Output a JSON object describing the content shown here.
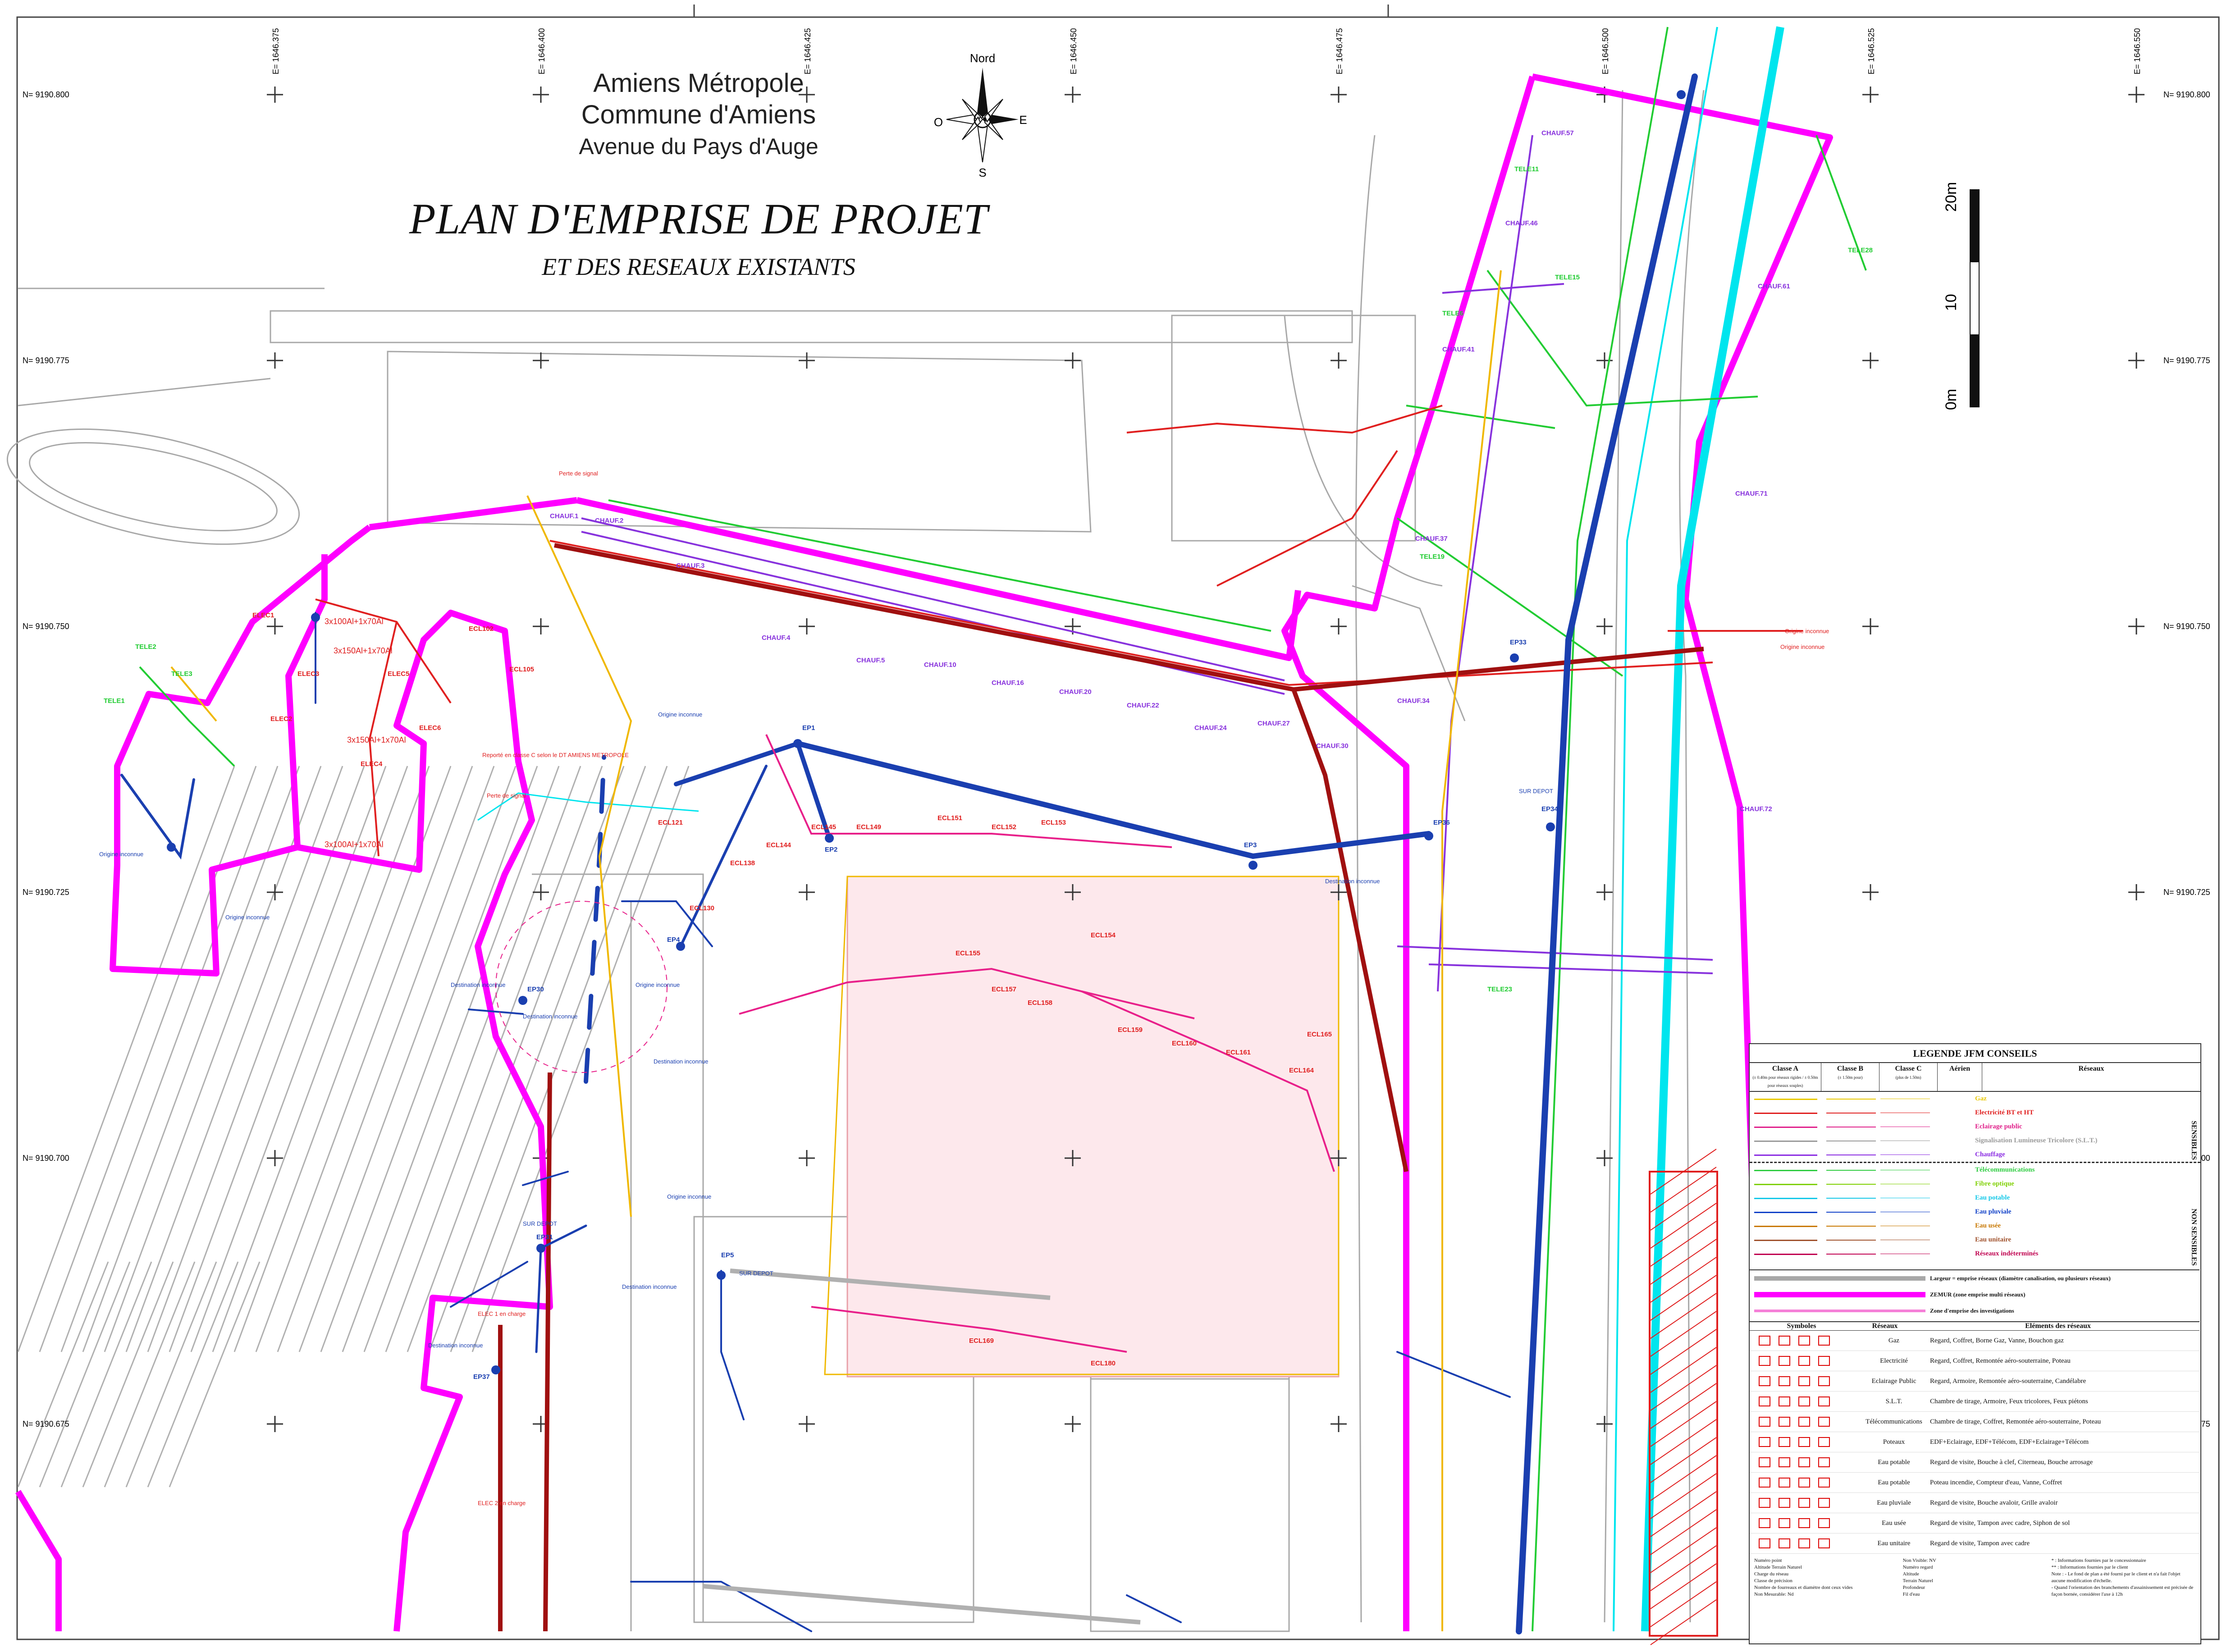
{
  "title": {
    "line1": "Amiens Métropole",
    "line2": "Commune d'Amiens",
    "line3": "Avenue du Pays d'Auge",
    "main": "PLAN D'EMPRISE DE PROJET",
    "sub": "ET DES RESEAUX EXISTANTS"
  },
  "compass": {
    "north": "Nord",
    "south": "S",
    "east": "E",
    "west": "O"
  },
  "scale": {
    "labels": [
      "0m",
      "10",
      "20m"
    ]
  },
  "grid": {
    "eastings": [
      "E= 1646.375",
      "E= 1646.400",
      "E= 1646.425",
      "E= 1646.450",
      "E= 1646.475",
      "E= 1646.500",
      "E= 1646.525",
      "E= 1646.550"
    ],
    "northings": [
      "N= 9190.800",
      "N= 9190.775",
      "N= 9190.750",
      "N= 9190.725",
      "N= 9190.700",
      "N= 9190.675"
    ]
  },
  "annotations": {
    "origine": "Origine inconnue",
    "destination": "Destination inconnue",
    "sur_depot": "SUR DEPOT",
    "elec_charge": "ELEC 1 en charge",
    "elec_charge2": "ELEC 2 en charge",
    "report": "Reporté en classe C selon le DT AMIENS METROPOLE",
    "perte": "Perte de signal",
    "cable1": "3x150Al+1x70Al",
    "cable2": "3x100Al+1x70Al",
    "emprise": "ZEMUR"
  },
  "labels_red": [
    "ELEC1",
    "ELEC2",
    "ELEC3",
    "ELEC4",
    "ELEC5",
    "ELEC6",
    "ECL102",
    "ECL105",
    "ECL121",
    "ECL130",
    "ECL138",
    "ECL144",
    "ECL145",
    "ECL149",
    "ECL151",
    "ECL152",
    "ECL153",
    "ECL154",
    "ECL155",
    "ECL157",
    "ECL158",
    "ECL159",
    "ECL160",
    "ECL161",
    "ECL164",
    "ECL165",
    "ECL169",
    "ECL180"
  ],
  "labels_purple": [
    "CHAUF.1",
    "CHAUF.2",
    "CHAUF.3",
    "CHAUF.4",
    "CHAUF.5",
    "CHAUF.10",
    "CHAUF.16",
    "CHAUF.20",
    "CHAUF.22",
    "CHAUF.24",
    "CHAUF.27",
    "CHAUF.30",
    "CHAUF.34",
    "CHAUF.37",
    "CHAUF.41",
    "CHAUF.46",
    "CHAUF.57",
    "CHAUF.61",
    "CHAUF.71",
    "CHAUF.72"
  ],
  "labels_green": [
    "TELE1",
    "TELE2",
    "TELE3",
    "TELE6",
    "TELE11",
    "TELE15",
    "TELE19",
    "TELE23",
    "TELE28"
  ],
  "labels_blue": [
    "EP1",
    "EP2",
    "EP3",
    "EP4",
    "EP5",
    "EP30",
    "EP31",
    "EP33",
    "EP34",
    "EP36",
    "EP37"
  ],
  "legend": {
    "title": "LEGENDE JFM CONSEILS",
    "cols": [
      "Classe A",
      "Classe B",
      "Classe C",
      "Aérien",
      "Réseaux"
    ],
    "col_notes": [
      "(± 0.40m pour réseaux rigides / ± 0.50m pour réseaux souples)",
      "(± 1.50m pour)",
      "(plus de 1.50m)"
    ],
    "networks": [
      {
        "name": "Gaz",
        "color": "#e8c800"
      },
      {
        "name": "Electricité BT et HT",
        "color": "#e02020"
      },
      {
        "name": "Eclairage public",
        "color": "#e0208a"
      },
      {
        "name": "Signalisation Lumineuse Tricolore (S.L.T.)",
        "color": "#9a9a9a"
      },
      {
        "name": "Chauffage",
        "color": "#8a2be2"
      },
      {
        "name": "Télécommunications",
        "color": "#2ecc40"
      },
      {
        "name": "Fibre optique",
        "color": "#7fd000"
      },
      {
        "name": "Eau potable",
        "color": "#14c8e8"
      },
      {
        "name": "Eau pluviale",
        "color": "#1040c8"
      },
      {
        "name": "Eau usée",
        "color": "#c87800"
      },
      {
        "name": "Eau unitaire",
        "color": "#a0522d"
      },
      {
        "name": "Réseaux indéterminés",
        "color": "#c00050"
      }
    ],
    "sens_top": "SENSIBLES",
    "sens_bottom": "NON SENSIBLES",
    "emprise_rows": [
      "Largeur = emprise réseaux (diamètre canalisation, ou plusieurs réseaux)",
      "ZEMUR (zone emprise multi réseaux)",
      "Zone d'emprise des investigations"
    ],
    "sym_cols": [
      "Symboles",
      "Réseaux",
      "Eléments des réseaux"
    ],
    "symbols": [
      {
        "net": "Gaz",
        "el": "Regard, Coffret, Borne Gaz, Vanne, Bouchon gaz"
      },
      {
        "net": "Electricité",
        "el": "Regard, Coffret, Remontée aéro-souterraine, Poteau"
      },
      {
        "net": "Eclairage Public",
        "el": "Regard, Armoire, Remontée aéro-souterraine, Candélabre"
      },
      {
        "net": "S.L.T.",
        "el": "Chambre de tirage, Armoire, Feux tricolores, Feux piétons"
      },
      {
        "net": "Télécommunications",
        "el": "Chambre de tirage, Coffret, Remontée aéro-souterraine, Poteau"
      },
      {
        "net": "Poteaux",
        "el": "EDF+Eclairage, EDF+Télécom, EDF+Eclairage+Télécom"
      },
      {
        "net": "Eau potable",
        "el": "Regard de visite, Bouche à clef, Citerneau, Bouche arrosage"
      },
      {
        "net": "Eau potable",
        "el": "Poteau incendie, Compteur d'eau, Vanne, Coffret"
      },
      {
        "net": "Eau pluviale",
        "el": "Regard de visite, Bouche avaloir, Grille avaloir"
      },
      {
        "net": "Eau usée",
        "el": "Regard de visite, Tampon avec cadre, Siphon de sol"
      },
      {
        "net": "Eau unitaire",
        "el": "Regard de visite, Tampon avec cadre"
      }
    ],
    "footer": [
      "Numéro point",
      "Altitude Terrain Naturel",
      "Charge du réseau",
      "Classe de précision",
      "Nombre de fourreaux et diamètre dont ceux vides",
      "Non Mesurable: Nd",
      "Non Visible: NV",
      "Numéro regard",
      "Altitude",
      "Terrain Naturel",
      "Profondeur",
      "Fil d'eau",
      "* : Informations fournies par le concessionnaire",
      "** : Informations fournies par le client",
      "Note : - Le fond de plan a été fourni par le client et n'a fait l'objet aucune modification d'échelle.",
      "- Quand l'orientation des branchements d'assainissement est précisée de façon bornée, considérer l'axe à 12h"
    ]
  },
  "colors": {
    "emprise": "#ff00ff",
    "eau_potable": "#00e5ee",
    "eau_pluviale": "#1a3fb0",
    "electricite": "#e02020",
    "unitaire": "#a01010",
    "gaz": "#f0b800",
    "telecom": "#22cc33",
    "chauffage": "#8833dd",
    "eclairage": "#e8208a",
    "background": "#9a9a9a"
  }
}
